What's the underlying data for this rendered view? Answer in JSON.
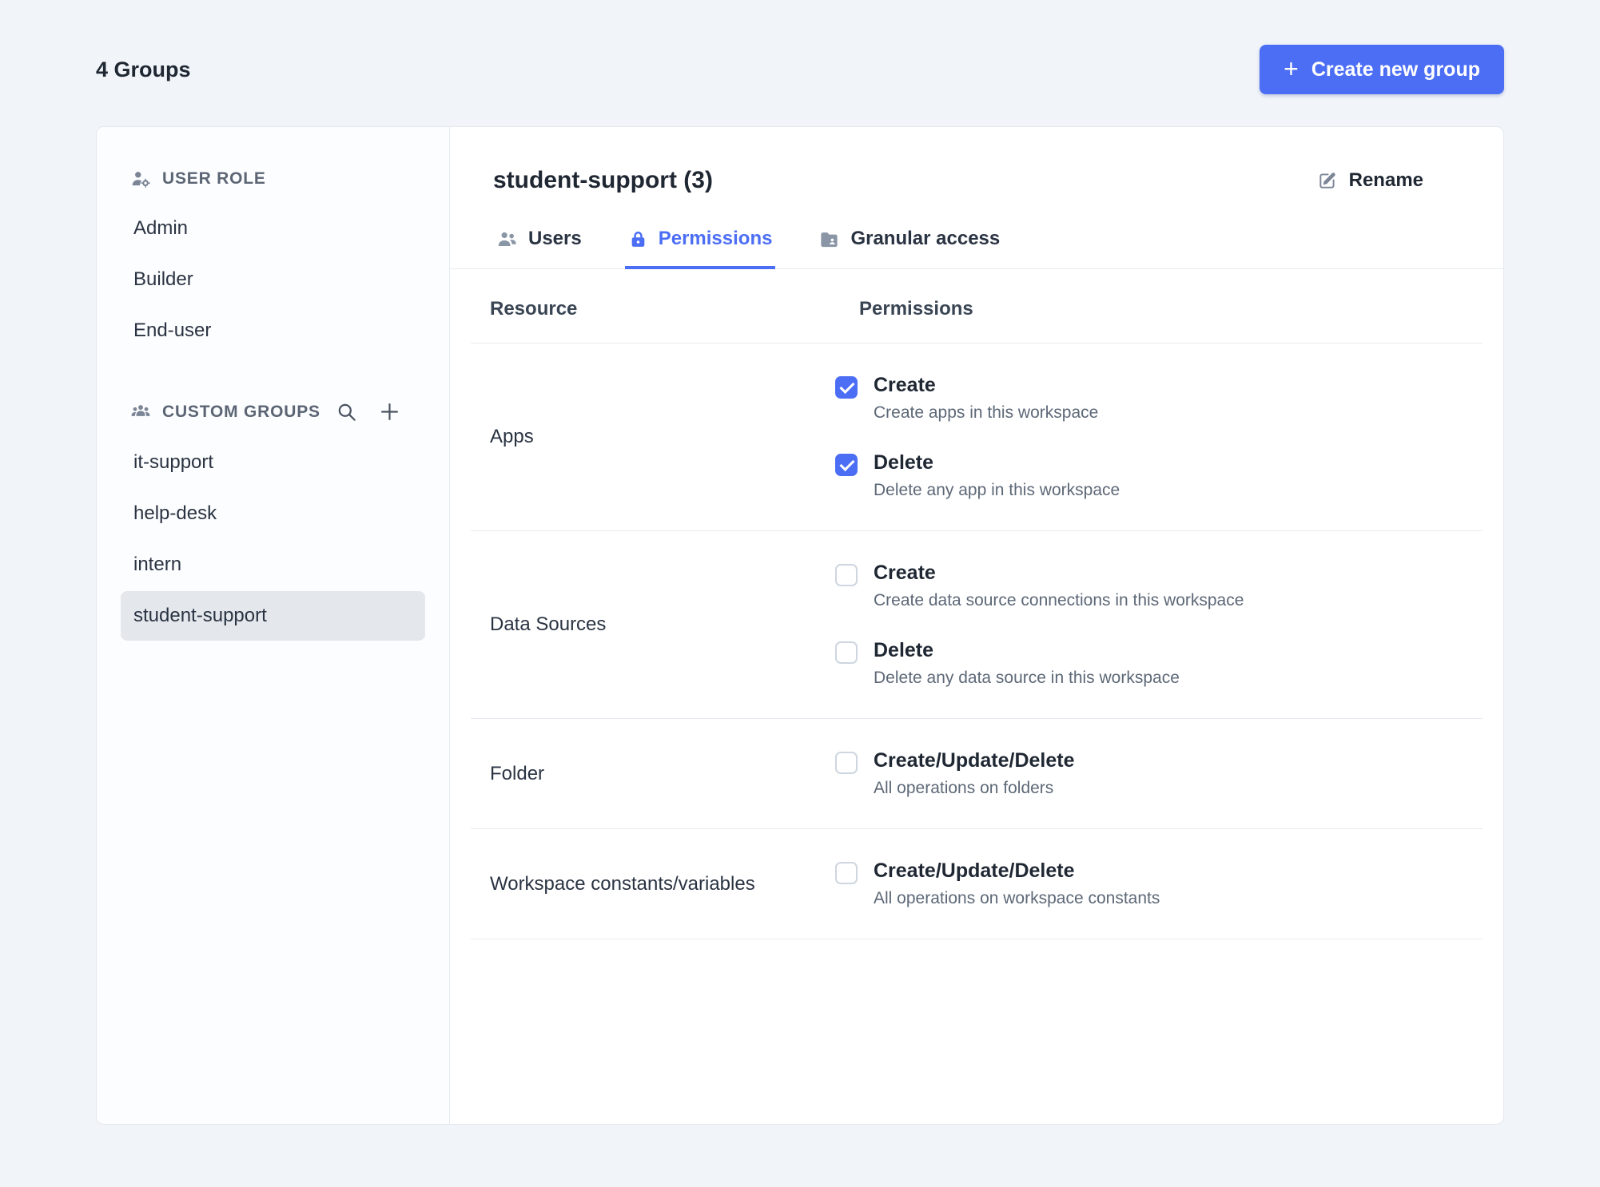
{
  "header": {
    "title": "4 Groups",
    "create_button_label": "Create new group",
    "plus_glyph": "+"
  },
  "sidebar": {
    "user_role": {
      "label": "USER ROLE",
      "items": [
        {
          "label": "Admin"
        },
        {
          "label": "Builder"
        },
        {
          "label": "End-user"
        }
      ]
    },
    "custom_groups": {
      "label": "CUSTOM GROUPS",
      "items": [
        {
          "label": "it-support"
        },
        {
          "label": "help-desk"
        },
        {
          "label": "intern"
        },
        {
          "label": "student-support"
        }
      ],
      "selected": "student-support"
    }
  },
  "main": {
    "title": "student-support (3)",
    "rename_label": "Rename",
    "tabs": [
      {
        "label": "Users",
        "active": false
      },
      {
        "label": "Permissions",
        "active": true
      },
      {
        "label": "Granular access",
        "active": false
      }
    ],
    "table": {
      "columns": {
        "resource": "Resource",
        "permissions": "Permissions"
      },
      "rows": [
        {
          "resource": "Apps",
          "permissions": [
            {
              "label": "Create",
              "description": "Create apps in this workspace",
              "checked": true
            },
            {
              "label": "Delete",
              "description": "Delete any app in this workspace",
              "checked": true
            }
          ]
        },
        {
          "resource": "Data Sources",
          "permissions": [
            {
              "label": "Create",
              "description": "Create data source connections in this workspace",
              "checked": false
            },
            {
              "label": "Delete",
              "description": "Delete any data source in this workspace",
              "checked": false
            }
          ]
        },
        {
          "resource": "Folder",
          "permissions": [
            {
              "label": "Create/Update/Delete",
              "description": "All operations on folders",
              "checked": false
            }
          ]
        },
        {
          "resource": "Workspace constants/variables",
          "permissions": [
            {
              "label": "Create/Update/Delete",
              "description": "All operations on workspace constants",
              "checked": false
            }
          ]
        }
      ]
    }
  },
  "icons": {
    "user_role": "person-gear-icon",
    "custom_groups": "people-group-icon",
    "search": "search-icon",
    "add_group": "plus-icon",
    "users_tab": "people-icon",
    "permissions_tab": "lock-icon",
    "granular_tab": "folder-icon",
    "rename": "pencil-icon"
  },
  "colors": {
    "accent": "#4c6ef5",
    "page_background": "#f1f5f9",
    "card_background": "#ffffff",
    "border": "#e7eaef",
    "selected_item_background": "#e4e7eb",
    "muted_text": "#5d6877",
    "icon_gray": "#7b8596"
  }
}
